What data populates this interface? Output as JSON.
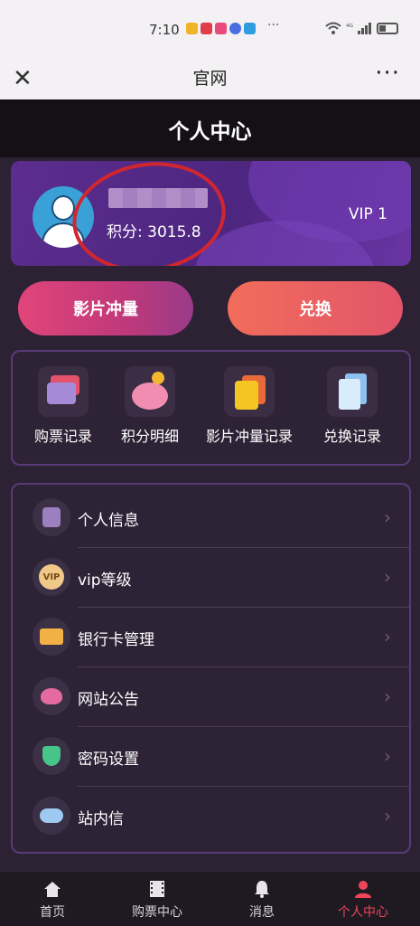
{
  "status_bar": {
    "time": "7:10",
    "overflow": "···",
    "signal": "⁴ᴳ"
  },
  "webview": {
    "title": "官网",
    "close_glyph": "✕",
    "more_glyph": "···"
  },
  "header": {
    "title": "个人中心"
  },
  "profile": {
    "username_blurred": "",
    "points_label": "积分: 3015.8",
    "vip_level": "VIP 1"
  },
  "actions": {
    "boost_label": "影片冲量",
    "exchange_label": "兑换"
  },
  "quick_links": [
    {
      "label": "购票记录",
      "icon": "ticket-cards-icon"
    },
    {
      "label": "积分明细",
      "icon": "piggy-bank-icon"
    },
    {
      "label": "影片冲量记录",
      "icon": "film-boost-icon"
    },
    {
      "label": "兑换记录",
      "icon": "document-icon"
    }
  ],
  "menu": [
    {
      "label": "个人信息",
      "icon": "person-info-icon"
    },
    {
      "label": "vip等级",
      "icon": "vip-badge-icon",
      "icon_text": "VIP"
    },
    {
      "label": "银行卡管理",
      "icon": "bank-card-icon"
    },
    {
      "label": "网站公告",
      "icon": "speaker-icon"
    },
    {
      "label": "密码设置",
      "icon": "shield-icon"
    },
    {
      "label": "站内信",
      "icon": "cloud-message-icon"
    }
  ],
  "tabbar": [
    {
      "label": "首页",
      "icon": "home-icon",
      "active": false
    },
    {
      "label": "购票中心",
      "icon": "film-icon",
      "active": false
    },
    {
      "label": "消息",
      "icon": "bell-icon",
      "active": false
    },
    {
      "label": "个人中心",
      "icon": "user-icon",
      "active": true
    }
  ],
  "colors": {
    "active_tab": "#f0445a",
    "annotation_circle": "#d2262f"
  }
}
